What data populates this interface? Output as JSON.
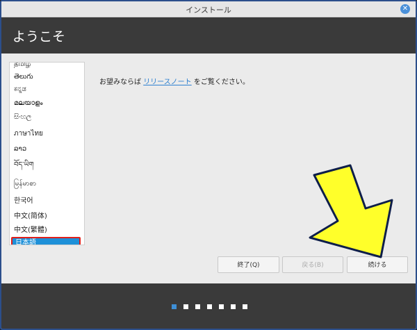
{
  "window": {
    "title": "インストール",
    "close_glyph": "✕"
  },
  "header": {
    "title": "ようこそ"
  },
  "language_list": {
    "items": [
      "தமிழ்",
      "తెలుగు",
      "ಕನ್ನಡ",
      "മലയാളം",
      "සිංහල",
      "ภาษาไทย",
      "ລາວ",
      "བོད་ཡིག",
      "မြန်မာစာ",
      "한국어",
      "中文(简体)",
      "中文(繁體)",
      "日本語"
    ],
    "selected": "日本語"
  },
  "welcome": {
    "before_link": "お望みならば ",
    "link_text": "リリースノート",
    "after_link": " をご覧ください。"
  },
  "buttons": {
    "quit": "終了(Q)",
    "back": "戻る(B)",
    "continue": "続ける"
  },
  "progress": {
    "steps": 7,
    "current": 1
  },
  "colors": {
    "accent": "#1e90d8",
    "selection_border": "#e0201b",
    "annotation_arrow": "#ffff2a",
    "header_bg": "#3a3a3a"
  }
}
